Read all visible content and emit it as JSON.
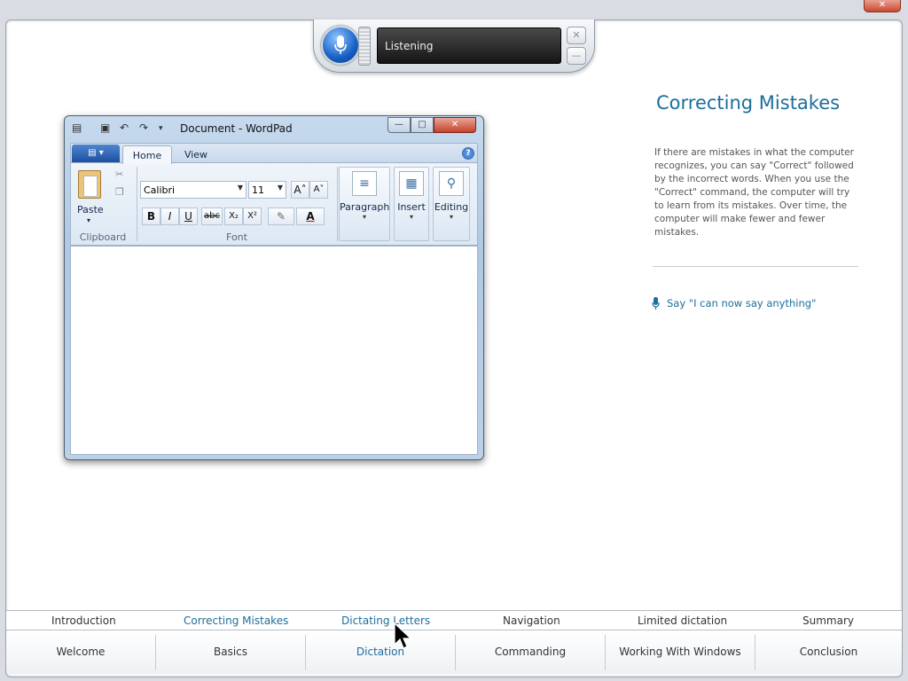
{
  "speech_bar": {
    "status": "Listening",
    "close_glyph": "✕",
    "minimize_glyph": "—"
  },
  "wordpad": {
    "title": "Document - WordPad",
    "app_menu_glyph": "▤ ▾",
    "tabs": [
      {
        "label": "Home"
      },
      {
        "label": "View"
      }
    ],
    "help_glyph": "?",
    "clipboard": {
      "paste_label": "Paste",
      "group_label": "Clipboard"
    },
    "font": {
      "family": "Calibri",
      "size": "11",
      "grow": "A˄",
      "shrink": "A˅",
      "bold": "B",
      "italic": "I",
      "underline": "U",
      "strikethrough": "abc",
      "subscript": "X₂",
      "superscript": "X²",
      "highlight": "✎",
      "color": "A",
      "group_label": "Font"
    },
    "paragraph_label": "Paragraph",
    "insert_label": "Insert",
    "editing_label": "Editing",
    "window_buttons": {
      "minimize": "—",
      "maximize": "□",
      "close": "✕"
    }
  },
  "lesson": {
    "title": "Correcting Mistakes",
    "body": "If there are mistakes in what the computer recognizes, you can say \"Correct\" followed by the incorrect words. When you use the \"Correct\" command, the computer will try to learn from its mistakes. Over time, the computer will make fewer and fewer mistakes.",
    "instruction": "Say \"I can now say anything\""
  },
  "subnav": [
    {
      "label": "Introduction"
    },
    {
      "label": "Correcting Mistakes"
    },
    {
      "label": "Dictating Letters"
    },
    {
      "label": "Navigation"
    },
    {
      "label": "Limited dictation"
    },
    {
      "label": "Summary"
    }
  ],
  "mainnav": [
    {
      "label": "Welcome"
    },
    {
      "label": "Basics"
    },
    {
      "label": "Dictation"
    },
    {
      "label": "Commanding"
    },
    {
      "label": "Working With Windows"
    },
    {
      "label": "Conclusion"
    }
  ],
  "colors": {
    "accent": "#1b6e9c",
    "mic_blue": "#1760c4",
    "close_red": "#c5422b"
  }
}
